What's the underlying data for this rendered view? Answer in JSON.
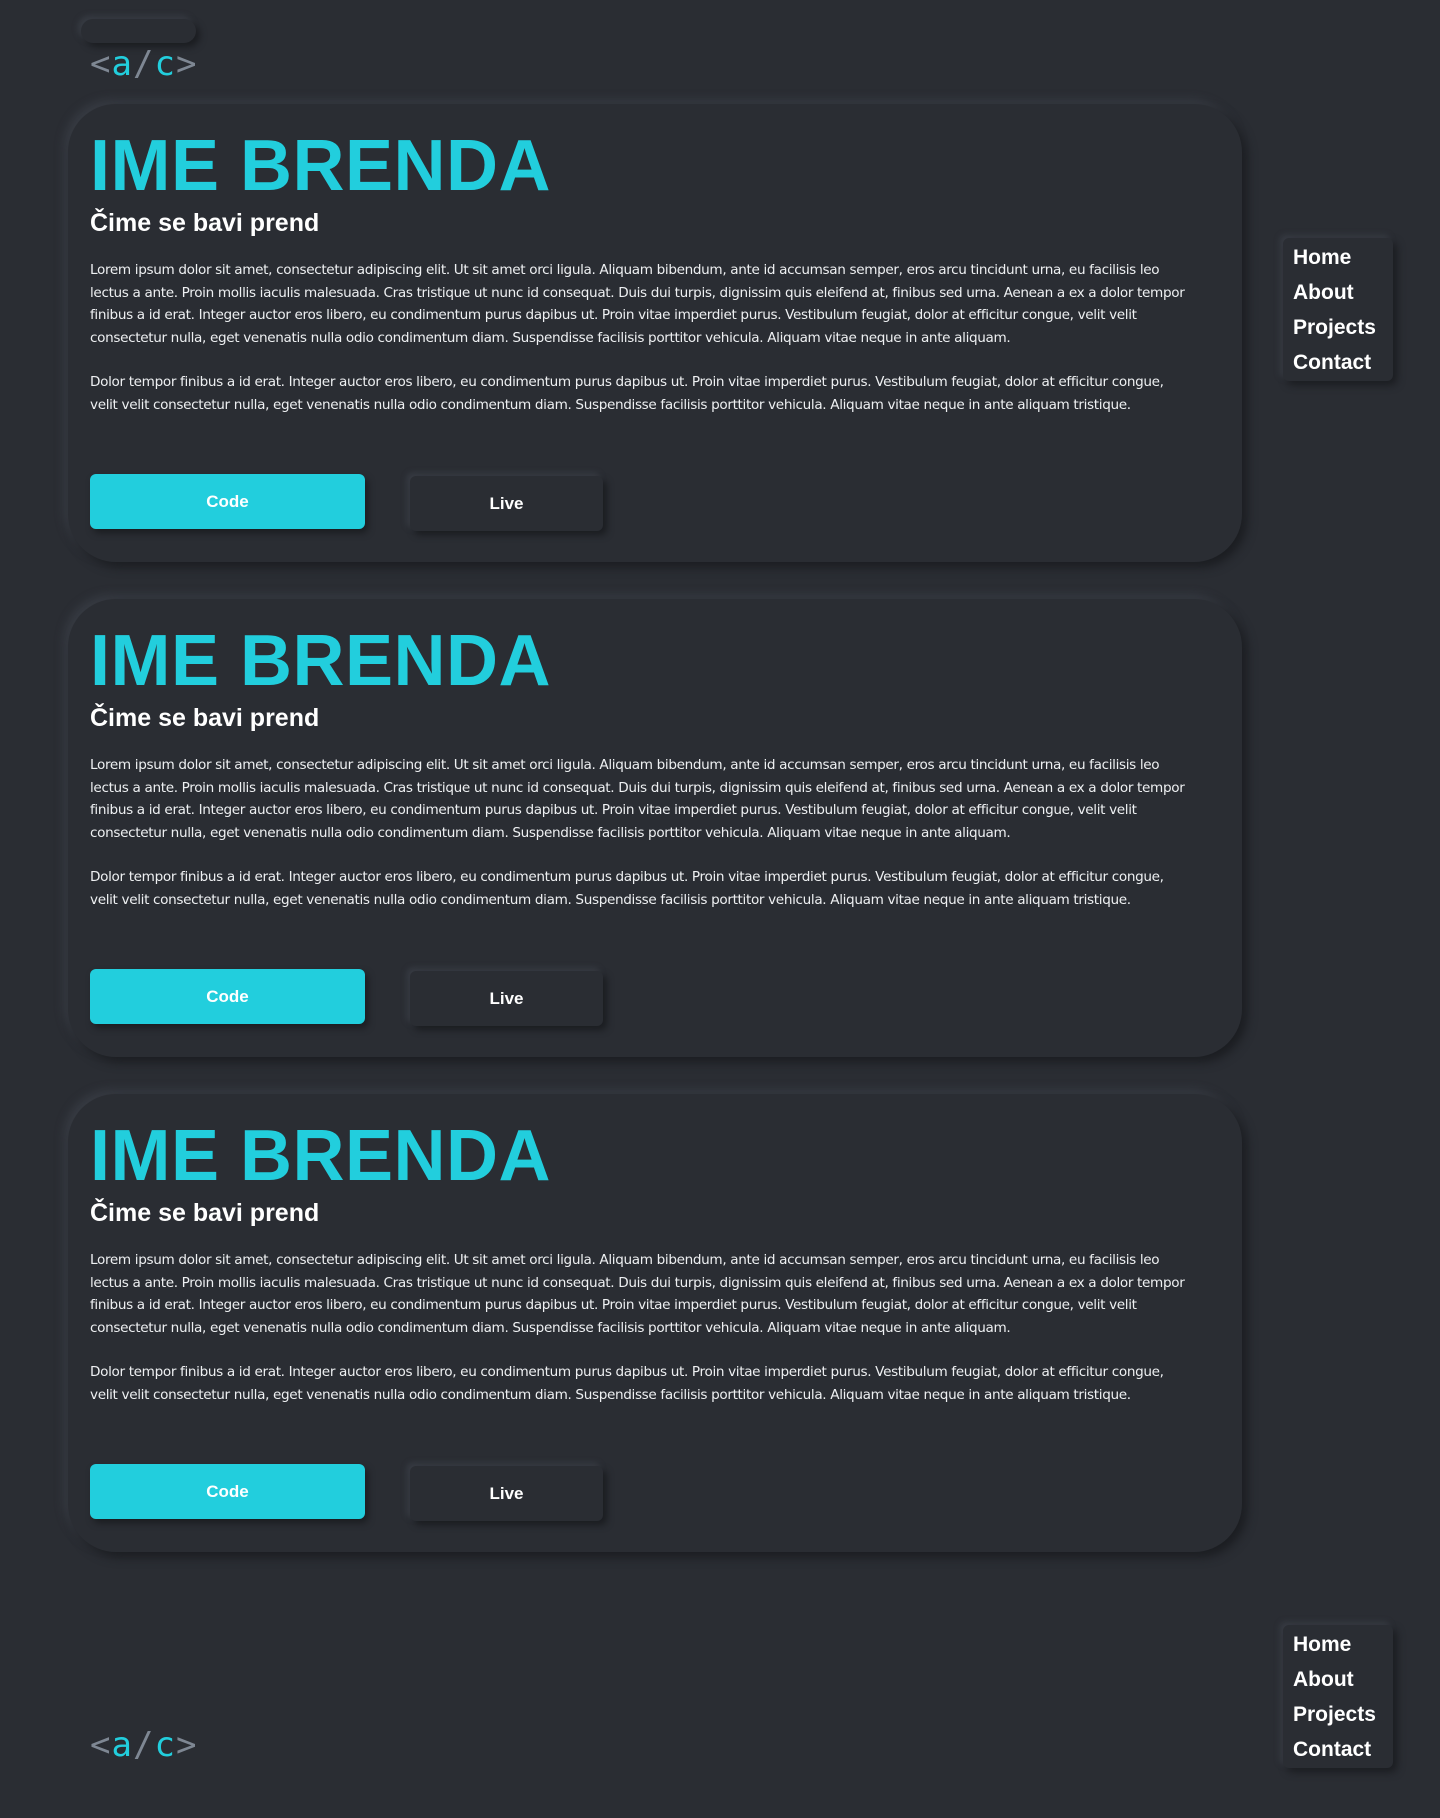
{
  "logo": {
    "open": "<",
    "a": "a",
    "slash": "/",
    "c": "c",
    "close": ">"
  },
  "nav": {
    "items": [
      {
        "label": "Home"
      },
      {
        "label": "About"
      },
      {
        "label": "Projects"
      },
      {
        "label": "Contact"
      }
    ]
  },
  "projects": [
    {
      "title": "IME BRENDA",
      "subtitle": "Čime se bavi prend",
      "paragraph1": "Lorem ipsum dolor sit amet, consectetur adipiscing elit. Ut sit amet orci ligula. Aliquam bibendum, ante id accumsan semper, eros arcu tincidunt urna, eu facilisis leo lectus a ante. Proin mollis iaculis malesuada. Cras tristique ut nunc id consequat. Duis dui turpis, dignissim quis eleifend at, finibus sed urna. Aenean a ex a dolor tempor finibus a id erat. Integer auctor eros libero, eu condimentum purus dapibus ut. Proin vitae imperdiet purus. Vestibulum feugiat, dolor at efficitur congue, velit velit consectetur nulla, eget venenatis nulla odio condimentum diam. Suspendisse facilisis porttitor vehicula. Aliquam vitae neque in ante aliquam.",
      "paragraph2": "Dolor tempor finibus a id erat. Integer auctor eros libero, eu condimentum purus dapibus ut. Proin vitae imperdiet purus. Vestibulum feugiat, dolor at efficitur congue, velit velit consectetur nulla, eget venenatis nulla odio condimentum diam. Suspendisse facilisis porttitor vehicula. Aliquam vitae neque in ante aliquam tristique.",
      "code_label": "Code",
      "live_label": "Live"
    },
    {
      "title": "IME BRENDA",
      "subtitle": "Čime se bavi prend",
      "paragraph1": "Lorem ipsum dolor sit amet, consectetur adipiscing elit. Ut sit amet orci ligula. Aliquam bibendum, ante id accumsan semper, eros arcu tincidunt urna, eu facilisis leo lectus a ante. Proin mollis iaculis malesuada. Cras tristique ut nunc id consequat. Duis dui turpis, dignissim quis eleifend at, finibus sed urna. Aenean a ex a dolor tempor finibus a id erat. Integer auctor eros libero, eu condimentum purus dapibus ut. Proin vitae imperdiet purus. Vestibulum feugiat, dolor at efficitur congue, velit velit consectetur nulla, eget venenatis nulla odio condimentum diam. Suspendisse facilisis porttitor vehicula. Aliquam vitae neque in ante aliquam.",
      "paragraph2": "Dolor tempor finibus a id erat. Integer auctor eros libero, eu condimentum purus dapibus ut. Proin vitae imperdiet purus. Vestibulum feugiat, dolor at efficitur congue, velit velit consectetur nulla, eget venenatis nulla odio condimentum diam. Suspendisse facilisis porttitor vehicula. Aliquam vitae neque in ante aliquam tristique.",
      "code_label": "Code",
      "live_label": "Live"
    },
    {
      "title": "IME BRENDA",
      "subtitle": "Čime se bavi prend",
      "paragraph1": "Lorem ipsum dolor sit amet, consectetur adipiscing elit. Ut sit amet orci ligula. Aliquam bibendum, ante id accumsan semper, eros arcu tincidunt urna, eu facilisis leo lectus a ante. Proin mollis iaculis malesuada. Cras tristique ut nunc id consequat. Duis dui turpis, dignissim quis eleifend at, finibus sed urna. Aenean a ex a dolor tempor finibus a id erat. Integer auctor eros libero, eu condimentum purus dapibus ut. Proin vitae imperdiet purus. Vestibulum feugiat, dolor at efficitur congue, velit velit consectetur nulla, eget venenatis nulla odio condimentum diam. Suspendisse facilisis porttitor vehicula. Aliquam vitae neque in ante aliquam.",
      "paragraph2": "Dolor tempor finibus a id erat. Integer auctor eros libero, eu condimentum purus dapibus ut. Proin vitae imperdiet purus. Vestibulum feugiat, dolor at efficitur congue, velit velit consectetur nulla, eget venenatis nulla odio condimentum diam. Suspendisse facilisis porttitor vehicula. Aliquam vitae neque in ante aliquam tristique.",
      "code_label": "Code",
      "live_label": "Live"
    }
  ],
  "colors": {
    "background": "#2a2d33",
    "accent": "#22cedd",
    "bracket": "#7e8793",
    "text": "#ffffff"
  }
}
